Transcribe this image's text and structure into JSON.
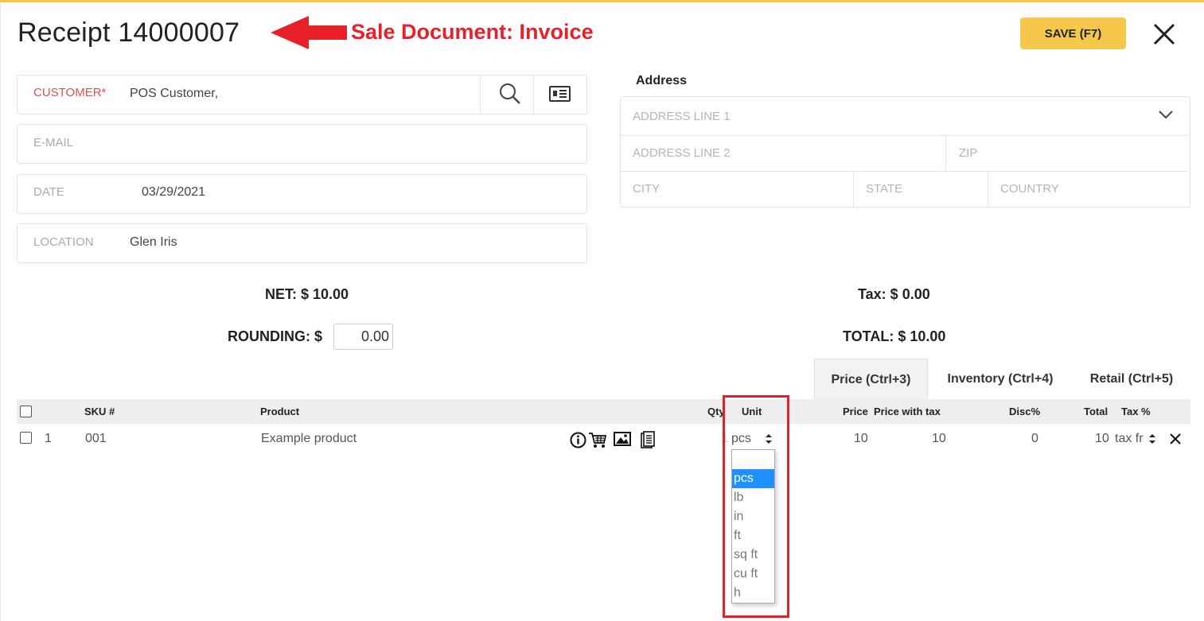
{
  "header": {
    "title": "Receipt 14000007",
    "annotation": "Sale Document: Invoice",
    "save_label": "SAVE (F7)"
  },
  "customer": {
    "label": "CUSTOMER*",
    "value": "POS Customer,"
  },
  "email": {
    "label": "E-MAIL",
    "value": ""
  },
  "date": {
    "label": "DATE",
    "value": "03/29/2021"
  },
  "location": {
    "label": "LOCATION",
    "value": "Glen Iris"
  },
  "address": {
    "title": "Address",
    "line1_placeholder": "ADDRESS LINE 1",
    "line2_placeholder": "ADDRESS LINE 2",
    "zip_placeholder": "ZIP",
    "city_placeholder": "CITY",
    "state_placeholder": "STATE",
    "country_placeholder": "COUNTRY"
  },
  "summary": {
    "net": "NET: $ 10.00",
    "tax": "Tax: $ 0.00",
    "rounding_label": "ROUNDING: $",
    "rounding_value": "0.00",
    "total": "TOTAL: $ 10.00"
  },
  "tabs": [
    {
      "label": "Price (Ctrl+3)",
      "active": true
    },
    {
      "label": "Inventory (Ctrl+4)",
      "active": false
    },
    {
      "label": "Retail (Ctrl+5)",
      "active": false
    }
  ],
  "table": {
    "headers": {
      "sku": "SKU #",
      "product": "Product",
      "qty": "Qty",
      "unit": "Unit",
      "price": "Price",
      "price_with_tax": "Price with tax",
      "disc": "Disc%",
      "total": "Total",
      "tax": "Tax %"
    },
    "rows": [
      {
        "num": "1",
        "sku": "001",
        "product": "Example product",
        "qty": "1",
        "unit": "pcs",
        "price": "10",
        "price_with_tax": "10",
        "disc": "0",
        "total": "10",
        "tax": "tax fr"
      }
    ]
  },
  "unit_dropdown": {
    "options": [
      "",
      "pcs",
      "lb",
      "in",
      "ft",
      "sq ft",
      "cu ft",
      "h"
    ],
    "selected": "pcs"
  },
  "colors": {
    "accent": "#f5c84c",
    "annotation": "#e8202a",
    "required": "#d9534f",
    "selected_option": "#1e90ff"
  }
}
